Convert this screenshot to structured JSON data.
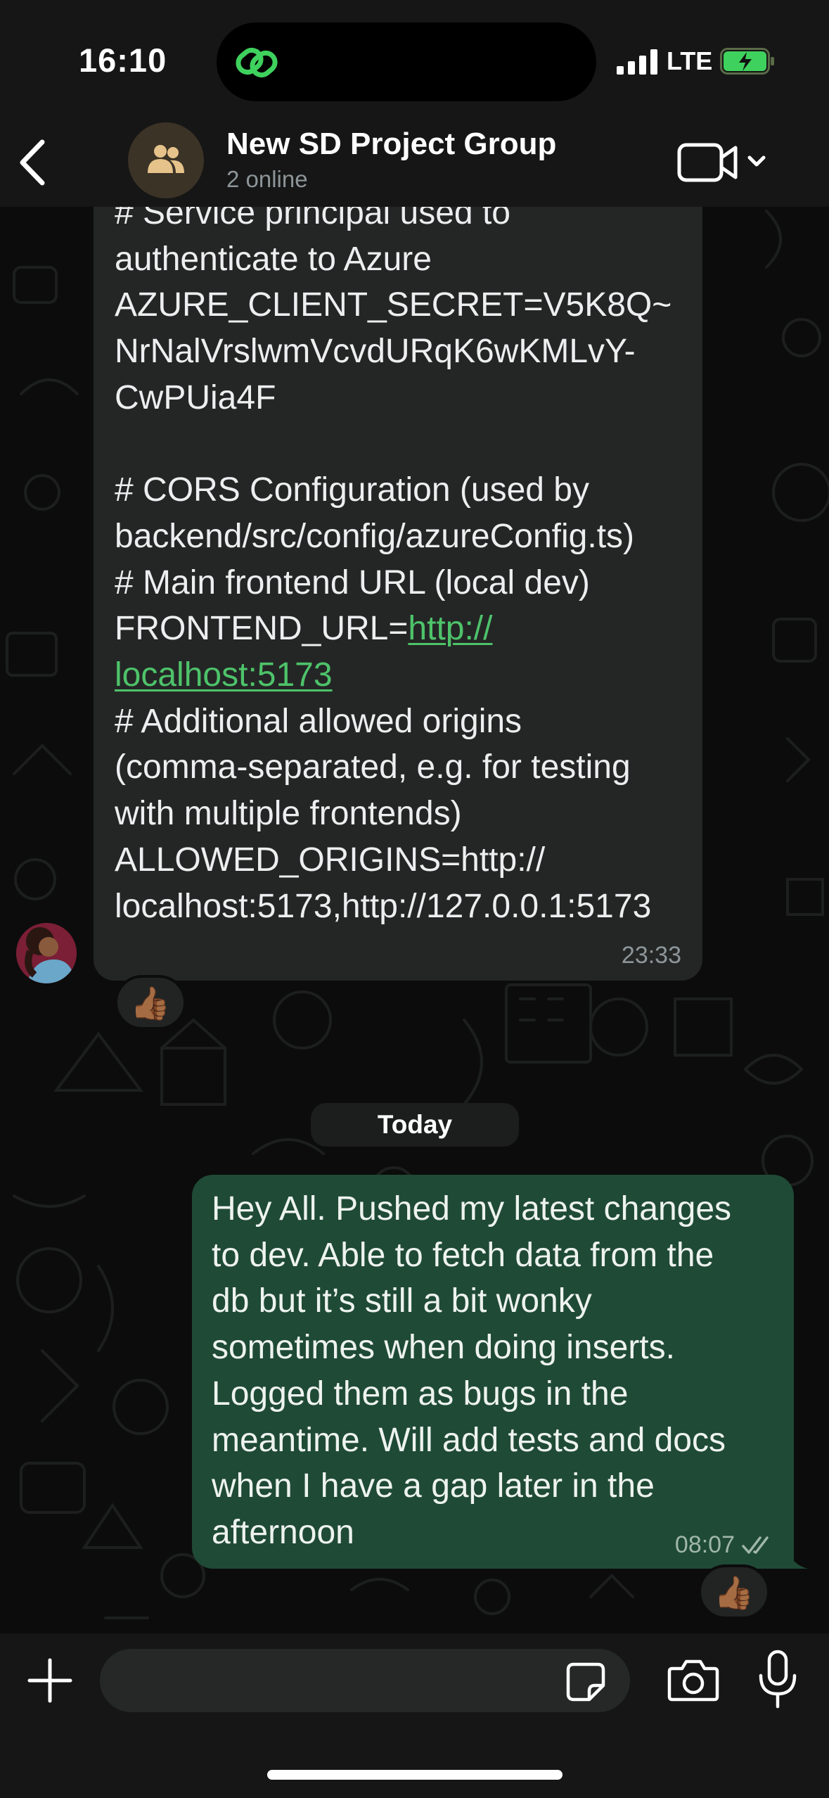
{
  "status_bar": {
    "time": "16:10",
    "network": "LTE",
    "icons": [
      "link-activity-icon",
      "signal-icon",
      "battery-charging-icon"
    ]
  },
  "header": {
    "title": "New SD Project Group",
    "subtitle": "2 online",
    "icons": [
      "back-chevron-icon",
      "group-icon",
      "video-camera-icon",
      "chevron-down-icon"
    ]
  },
  "messages": [
    {
      "direction": "incoming",
      "segments": {
        "before_link": "# Service principal used to\nauthenticate to Azure\nAZURE_CLIENT_SECRET=V5K8Q~\nNrNalVrslwmVcvdURqK6wKMLvY-\nCwPUia4F\n\n# CORS Configuration (used by\nbackend/src/config/azureConfig.ts)\n# Main frontend URL (local dev)\nFRONTEND_URL=",
        "link": "http://\nlocalhost:5173",
        "after_link": "\n# Additional allowed origins\n(comma-separated, e.g. for testing\nwith multiple frontends)\nALLOWED_ORIGINS=http://\nlocalhost:5173,http://127.0.0.1:5173"
      },
      "time": "23:33",
      "reaction": "👍🏾"
    },
    {
      "direction": "outgoing",
      "text": "Hey All. Pushed my latest changes\nto dev. Able to fetch data from the\ndb but it’s still a bit wonky\nsometimes when doing inserts.\nLogged them as bugs in the\nmeantime. Will add tests and docs\nwhen I have a gap later in the\nafternoon",
      "time": "08:07",
      "status": "read",
      "reaction": "👍🏾"
    }
  ],
  "date_separator": "Today",
  "input_bar": {
    "placeholder": "",
    "icons": [
      "plus-icon",
      "sticker-icon",
      "camera-icon",
      "microphone-icon"
    ]
  },
  "colors": {
    "outgoing_bubble": "#1f4a36",
    "incoming_bubble": "#242626",
    "link": "#4ec36a",
    "accent_green": "#3fd15d"
  }
}
